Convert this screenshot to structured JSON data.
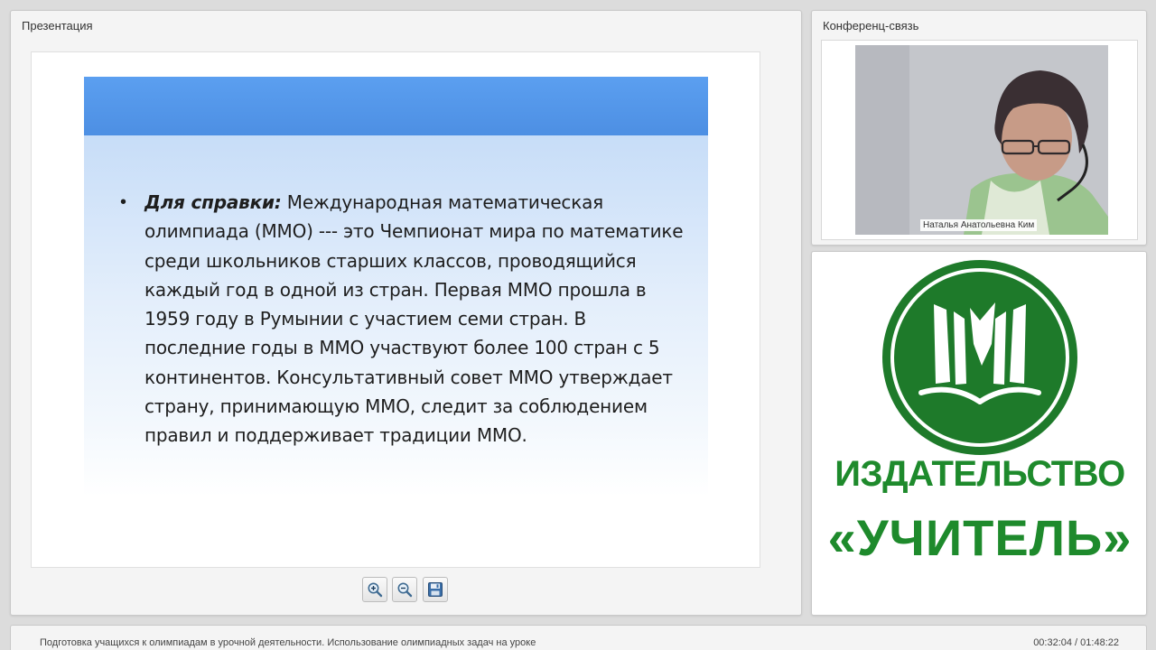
{
  "presentation": {
    "title": "Презентация",
    "slide": {
      "bullet": "•",
      "lead": "Для справки:",
      "text": " Международная математическая олимпиада (ММО) --- это Чемпионат мира по математике среди школьников старших классов, проводящийся каждый год в одной из стран. Первая ММО прошла в 1959 году в Румынии с участием семи стран. В последние годы в ММО участвуют более 100 стран с 5 континентов. Консультативный совет ММО утверждает страну, принимающую ММО, следит за соблюдением правил и поддерживает традиции ММО."
    },
    "toolbar": {
      "zoom_in_icon": "zoom-in-icon",
      "zoom_out_icon": "zoom-out-icon",
      "save_icon": "floppy-disk-icon"
    }
  },
  "conference": {
    "title": "Конференц-связь",
    "speaker_name": "Наталья Анатольевна Ким"
  },
  "logo": {
    "line1": "ИЗДАТЕЛЬСТВО",
    "line2": "«УЧИТЕЛЬ»",
    "color": "#1e8a2c"
  },
  "status": {
    "webinar_title": "Подготовка учащихся к олимпиадам в урочной деятельности. Использование олимпиадных задач на уроке",
    "time": "00:32:04 / 01:48:22"
  }
}
